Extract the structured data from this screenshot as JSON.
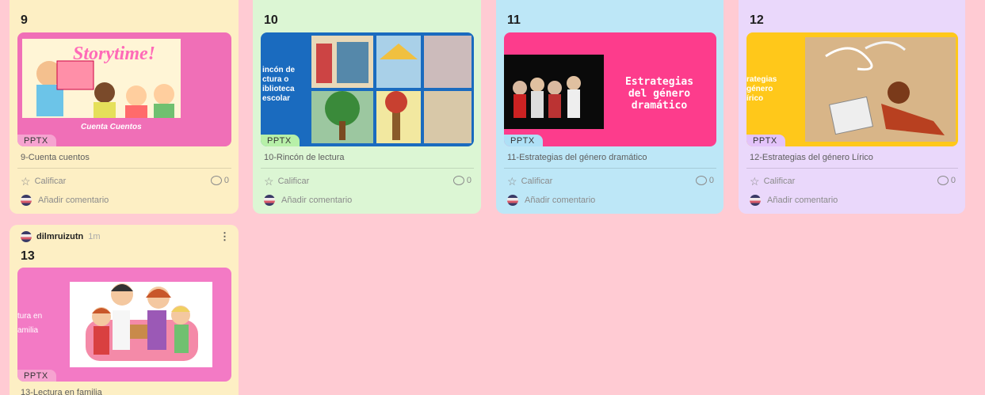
{
  "cards": [
    {
      "number": "9",
      "thumb_text": "Cuenta Cuentos",
      "thumb_heading": "Storytime!",
      "tag": "PPTX",
      "title": "9-Cuenta cuentos",
      "rate_label": "Calificar",
      "comment_count": "0",
      "add_comment": "Añadir comentario"
    },
    {
      "number": "10",
      "thumb_text": "incón de\nctura o\niblioteca\nescolar",
      "tag": "PPTX",
      "title": "10-Rincón de lectura",
      "rate_label": "Calificar",
      "comment_count": "0",
      "add_comment": "Añadir comentario"
    },
    {
      "number": "11",
      "thumb_text": "Estrategias\ndel género\ndramático",
      "tag": "PPTX",
      "title": "11-Estrategias del género dramático",
      "rate_label": "Calificar",
      "comment_count": "0",
      "add_comment": "Añadir comentario"
    },
    {
      "number": "12",
      "thumb_text": "rategias\ngénero\nírico",
      "tag": "PPTX",
      "title": "12-Estrategias del género Lírico",
      "rate_label": "Calificar",
      "comment_count": "0",
      "add_comment": "Añadir comentario"
    },
    {
      "author": "dilmruizutn",
      "time": "1m",
      "number": "13",
      "thumb_text": "tura en\namilia",
      "tag": "PPTX",
      "title": "13-Lectura en familia"
    }
  ],
  "colors": {
    "background": "#ffcbd3",
    "yellow_card": "#fdefc4",
    "green_card": "#dcf6d4",
    "blue_card": "#bde7f7",
    "purple_card": "#ead8fb"
  }
}
